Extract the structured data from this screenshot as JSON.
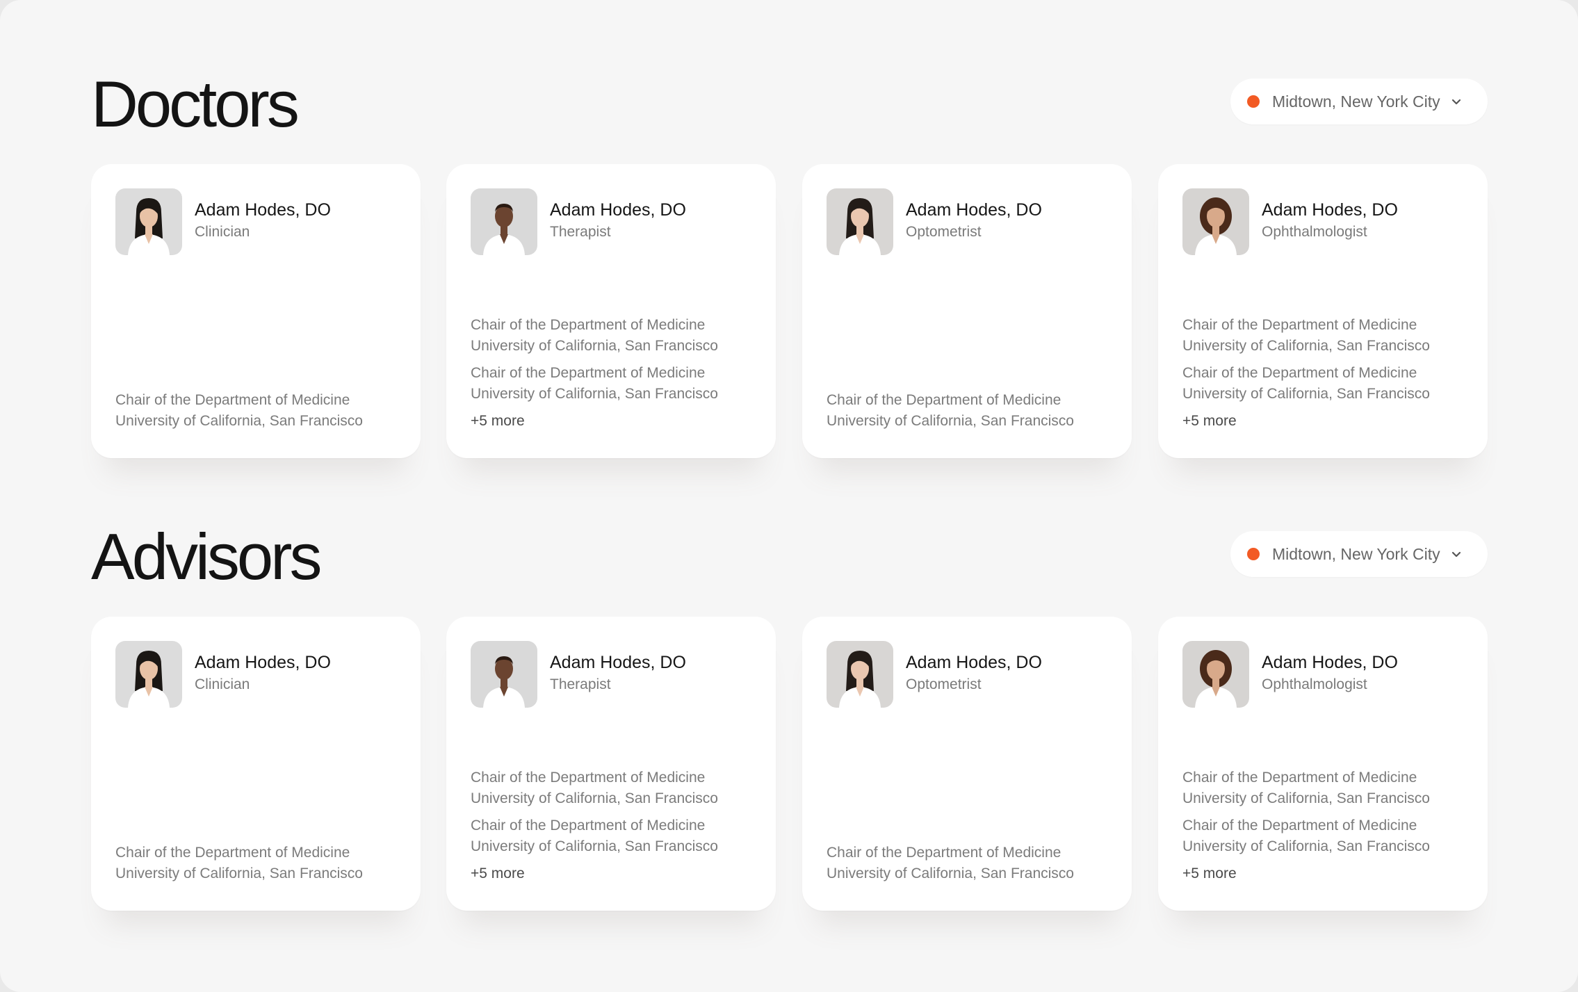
{
  "location_color": "#f25a24",
  "sections": [
    {
      "title": "Doctors",
      "location": "Midtown, New York City",
      "cards": [
        {
          "name": "Adam Hodes, DO",
          "role": "Clinician",
          "photo": "woman-asian-portrait",
          "credentials": [
            {
              "line1": "Chair of the Department of Medicine",
              "line2": "University of California, San Francisco"
            }
          ]
        },
        {
          "name": "Adam Hodes, DO",
          "role": "Therapist",
          "photo": "man-smiling-portrait",
          "credentials": [
            {
              "line1": "Chair of the Department of Medicine",
              "line2": "University of California, San Francisco"
            },
            {
              "line1": "Chair of the Department of Medicine",
              "line2": "University of California, San Francisco"
            }
          ],
          "more": "+5 more"
        },
        {
          "name": "Adam Hodes, DO",
          "role": "Optometrist",
          "photo": "woman-dark-hair-portrait",
          "credentials": [
            {
              "line1": "Chair of the Department of Medicine",
              "line2": "University of California, San Francisco"
            }
          ]
        },
        {
          "name": "Adam Hodes, DO",
          "role": "Ophthalmologist",
          "photo": "woman-curly-hair-portrait",
          "credentials": [
            {
              "line1": "Chair of the Department of Medicine",
              "line2": "University of California, San Francisco"
            },
            {
              "line1": "Chair of the Department of Medicine",
              "line2": "University of California, San Francisco"
            }
          ],
          "more": "+5 more"
        }
      ]
    },
    {
      "title": "Advisors",
      "location": "Midtown, New York City",
      "cards": [
        {
          "name": "Adam Hodes, DO",
          "role": "Clinician",
          "photo": "woman-asian-portrait",
          "credentials": [
            {
              "line1": "Chair of the Department of Medicine",
              "line2": "University of California, San Francisco"
            }
          ]
        },
        {
          "name": "Adam Hodes, DO",
          "role": "Therapist",
          "photo": "man-smiling-portrait",
          "credentials": [
            {
              "line1": "Chair of the Department of Medicine",
              "line2": "University of California, San Francisco"
            },
            {
              "line1": "Chair of the Department of Medicine",
              "line2": "University of California, San Francisco"
            }
          ],
          "more": "+5 more"
        },
        {
          "name": "Adam Hodes, DO",
          "role": "Optometrist",
          "photo": "woman-dark-hair-portrait",
          "credentials": [
            {
              "line1": "Chair of the Department of Medicine",
              "line2": "University of California, San Francisco"
            }
          ]
        },
        {
          "name": "Adam Hodes, DO",
          "role": "Ophthalmologist",
          "photo": "woman-curly-hair-portrait",
          "credentials": [
            {
              "line1": "Chair of the Department of Medicine",
              "line2": "University of California, San Francisco"
            },
            {
              "line1": "Chair of the Department of Medicine",
              "line2": "University of California, San Francisco"
            }
          ],
          "more": "+5 more"
        }
      ]
    }
  ]
}
